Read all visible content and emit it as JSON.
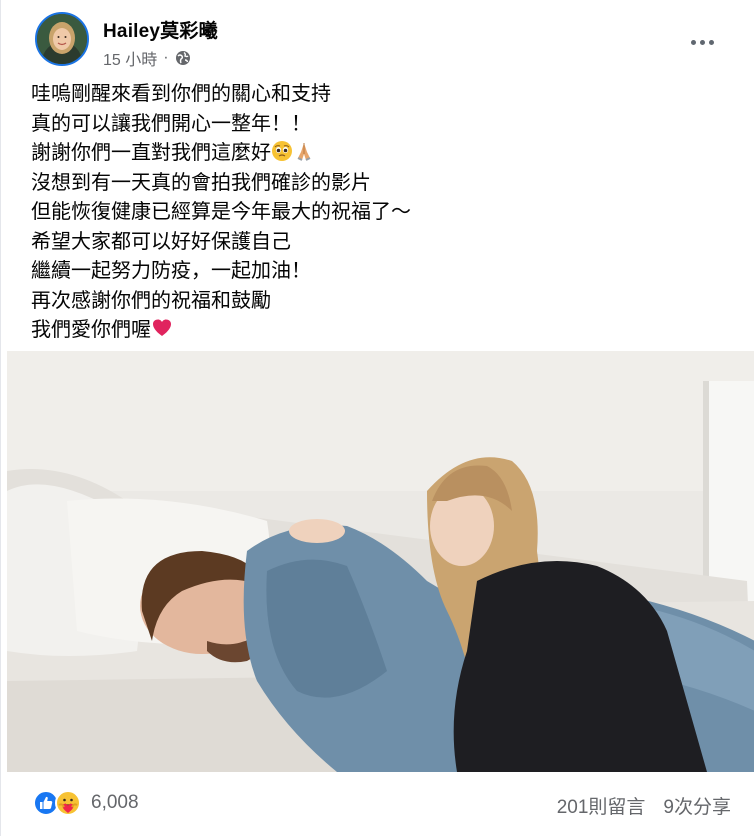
{
  "author": {
    "name": "Hailey莫彩曦",
    "time": "15 小時",
    "separator": "·",
    "privacy_icon": "globe-icon"
  },
  "post": {
    "lines": [
      "哇嗚剛醒來看到你們的關心和支持",
      "真的可以讓我們開心一整年！！",
      "謝謝你們一直對我們這麼好",
      "沒想到有一天真的會拍我們確診的影片",
      "但能恢復健康已經算是今年最大的祝福了～",
      "希望大家都可以好好保護自己",
      "繼續一起努力防疫，一起加油！",
      "再次感謝你們的祝福和鼓勵",
      "我們愛你們喔"
    ],
    "emojis": {
      "line3": [
        "pleading-face-icon",
        "folded-hands-icon"
      ],
      "line9": [
        "red-heart-icon"
      ]
    }
  },
  "photo": {
    "description_icon": "post-photo"
  },
  "footer": {
    "reaction_icons": [
      "like-icon",
      "care-icon"
    ],
    "reaction_count": "6,008",
    "comments": "201則留言",
    "shares": "9次分享"
  },
  "colors": {
    "brand_blue": "#1b74e4",
    "secondary_text": "#65676b",
    "heart_red": "#e0245e"
  }
}
